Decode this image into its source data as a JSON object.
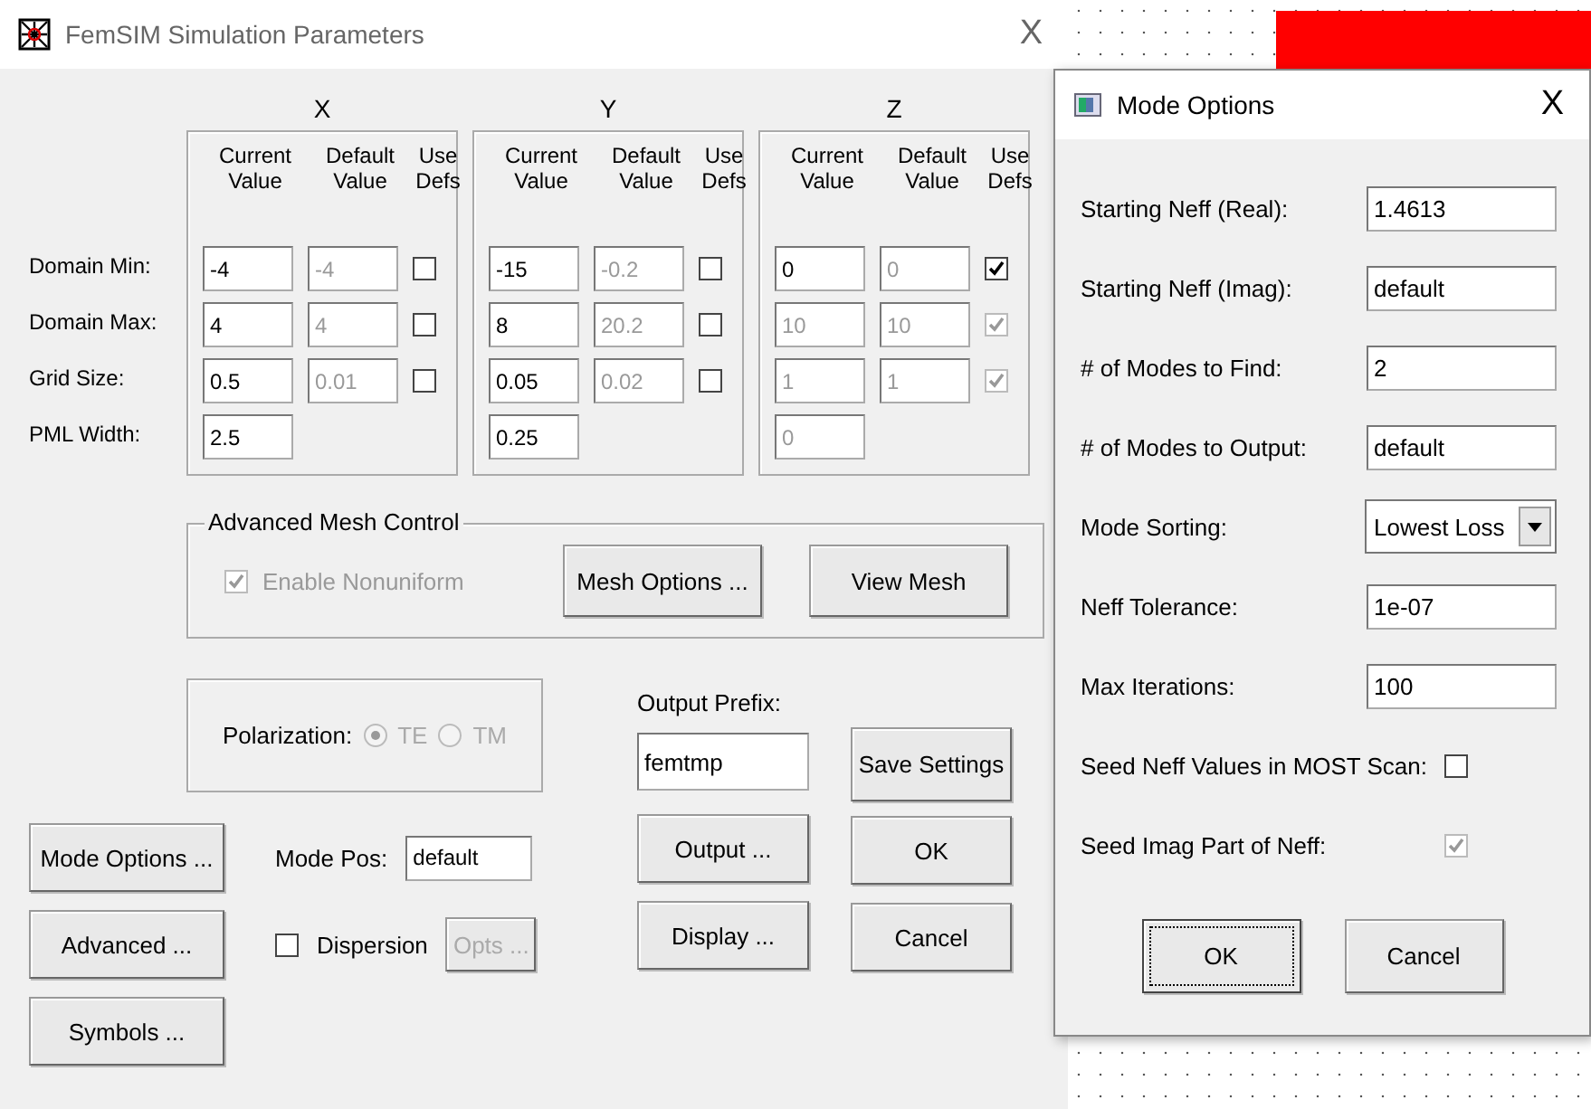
{
  "main_window": {
    "title": "FemSIM Simulation Parameters",
    "close": "X"
  },
  "axes": [
    {
      "label": "X",
      "headers": [
        "Current Value",
        "Default Value",
        "Use Defs"
      ],
      "rows": [
        {
          "current": "-4",
          "current_disabled": false,
          "default": "-4",
          "use_defs": false,
          "use_defs_disabled": false
        },
        {
          "current": "4",
          "current_disabled": false,
          "default": "4",
          "use_defs": false,
          "use_defs_disabled": false
        },
        {
          "current": "0.5",
          "current_disabled": false,
          "default": "0.01",
          "use_defs": false,
          "use_defs_disabled": false
        }
      ],
      "pml": {
        "value": "2.5",
        "disabled": false
      }
    },
    {
      "label": "Y",
      "headers": [
        "Current Value",
        "Default Value",
        "Use Defs"
      ],
      "rows": [
        {
          "current": "-15",
          "current_disabled": false,
          "default": "-0.2",
          "use_defs": false,
          "use_defs_disabled": false
        },
        {
          "current": "8",
          "current_disabled": false,
          "default": "20.2",
          "use_defs": false,
          "use_defs_disabled": false
        },
        {
          "current": "0.05",
          "current_disabled": false,
          "default": "0.02",
          "use_defs": false,
          "use_defs_disabled": false
        }
      ],
      "pml": {
        "value": "0.25",
        "disabled": false
      }
    },
    {
      "label": "Z",
      "headers": [
        "Current Value",
        "Default Value",
        "Use Defs"
      ],
      "rows": [
        {
          "current": "0",
          "current_disabled": false,
          "default": "0",
          "use_defs": true,
          "use_defs_disabled": false
        },
        {
          "current": "10",
          "current_disabled": true,
          "default": "10",
          "use_defs": true,
          "use_defs_disabled": true
        },
        {
          "current": "1",
          "current_disabled": true,
          "default": "1",
          "use_defs": true,
          "use_defs_disabled": true
        }
      ],
      "pml": {
        "value": "0",
        "disabled": true
      }
    }
  ],
  "row_labels": [
    "Domain Min:",
    "Domain Max:",
    "Grid Size:",
    "PML Width:"
  ],
  "mesh": {
    "title": "Advanced Mesh Control",
    "nonuniform": {
      "label": "Enable Nonuniform",
      "checked": true,
      "disabled": true
    },
    "buttons": [
      "Mesh Options ...",
      "View Mesh"
    ]
  },
  "polarization": {
    "label": "Polarization:",
    "disabled": true,
    "options": [
      {
        "label": "TE",
        "selected": true
      },
      {
        "label": "TM",
        "selected": false
      }
    ]
  },
  "output_prefix": {
    "label": "Output Prefix:",
    "value": "femtmp"
  },
  "mode_pos": {
    "label": "Mode Pos:",
    "value": "default"
  },
  "dispersion": {
    "label": "Dispersion",
    "checked": false,
    "opts": "Opts ...",
    "opts_disabled": true
  },
  "buttons": {
    "save": "Save Settings",
    "mode_options": "Mode Options ...",
    "output": "Output ...",
    "ok": "OK",
    "advanced": "Advanced ...",
    "display": "Display ...",
    "cancel": "Cancel",
    "symbols": "Symbols ..."
  },
  "mode_dialog": {
    "title": "Mode Options",
    "close": "X",
    "rows": [
      {
        "kind": "field",
        "label": "Starting Neff (Real):",
        "value": "1.4613"
      },
      {
        "kind": "field",
        "label": "Starting Neff (Imag):",
        "value": "default"
      },
      {
        "kind": "field",
        "label": "# of Modes to Find:",
        "value": "2"
      },
      {
        "kind": "field",
        "label": "# of Modes to Output:",
        "value": "default"
      },
      {
        "kind": "select",
        "label": "Mode Sorting:",
        "value": "Lowest Loss"
      },
      {
        "kind": "field",
        "label": "Neff Tolerance:",
        "value": "1e-07"
      },
      {
        "kind": "field",
        "label": "Max Iterations:",
        "value": "100"
      },
      {
        "kind": "checkbox",
        "label": "Seed Neff Values in MOST Scan:",
        "checked": false,
        "disabled": false
      },
      {
        "kind": "checkbox",
        "label": "Seed Imag Part of Neff:",
        "checked": true,
        "disabled": true
      }
    ],
    "buttons": [
      {
        "label": "OK",
        "focused": true
      },
      {
        "label": "Cancel",
        "focused": false
      }
    ]
  }
}
